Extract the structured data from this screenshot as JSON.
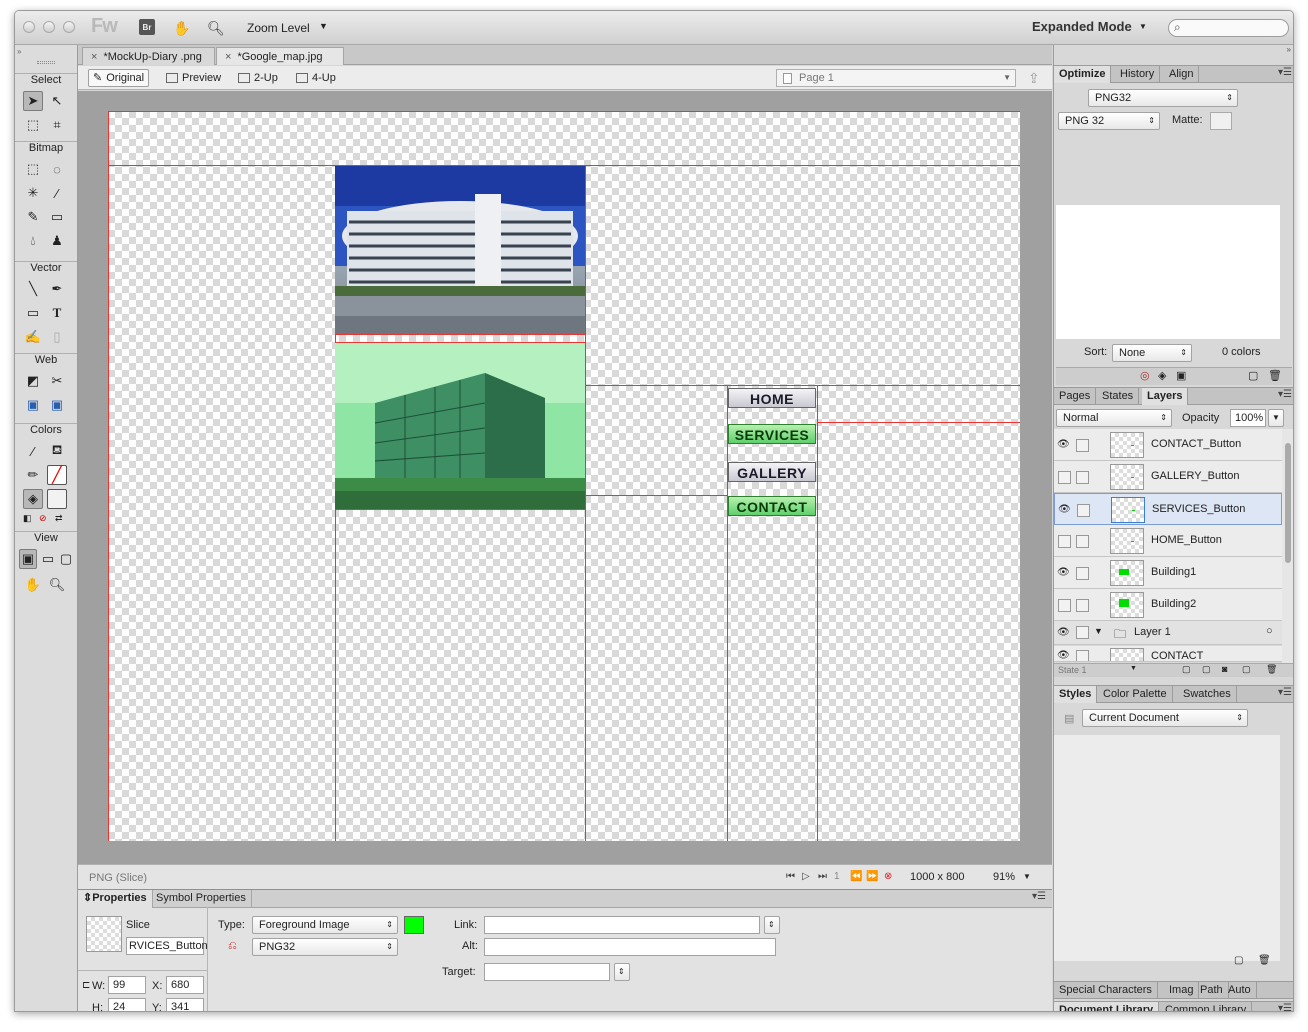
{
  "titlebar": {
    "app_logo": "Fw",
    "bridge_badge": "Br",
    "zoom_level_label": "Zoom Level",
    "workspace_label": "Expanded Mode",
    "search_placeholder": ""
  },
  "tools": {
    "sections": [
      "Select",
      "Bitmap",
      "Vector",
      "Web",
      "Colors",
      "View"
    ]
  },
  "doc_tabs": [
    {
      "label": "*MockUp-Diary .png",
      "close": "×"
    },
    {
      "label": "*Google_map.jpg",
      "close": "×"
    }
  ],
  "view_tabs": {
    "original": "Original",
    "preview": "Preview",
    "two_up": "2-Up",
    "four_up": "4-Up",
    "page_select": "Page 1"
  },
  "canvas": {
    "nav_buttons": [
      {
        "label": "HOME",
        "style": "gray"
      },
      {
        "label": "SERVICES",
        "style": "green"
      },
      {
        "label": "GALLERY",
        "style": "gray"
      },
      {
        "label": "CONTACT",
        "style": "green"
      }
    ]
  },
  "status": {
    "label": "PNG (Slice)",
    "frame_number": "1",
    "doc_size": "1000 x 800",
    "zoom": "91%"
  },
  "properties": {
    "tabs": [
      "Properties",
      "Symbol Properties"
    ],
    "object_kind": "Slice",
    "object_name": "RVICES_Button",
    "type_label": "Type:",
    "type_value": "Foreground Image",
    "format_value": "PNG32",
    "link_label": "Link:",
    "link_value": "",
    "alt_label": "Alt:",
    "alt_value": "",
    "target_label": "Target:",
    "target_value": "",
    "w_label": "W:",
    "w_value": "99",
    "h_label": "H:",
    "h_value": "24",
    "x_label": "X:",
    "x_value": "680",
    "y_label": "Y:",
    "y_value": "341",
    "slice_color": "#00ff00"
  },
  "optimize_panel": {
    "tabs": [
      "Optimize",
      "History",
      "Align"
    ],
    "preset": "PNG32",
    "format": "PNG 32",
    "matte_label": "Matte:",
    "sort_label": "Sort:",
    "sort_value": "None",
    "colors_count": "0 colors"
  },
  "layers_panel": {
    "tabs": [
      "Pages",
      "States",
      "Layers"
    ],
    "blend_mode": "Normal",
    "opacity_label": "Opacity",
    "opacity_value": "100%",
    "layers": [
      {
        "name": "CONTACT_Button",
        "visible": true,
        "selected": false
      },
      {
        "name": "GALLERY_Button",
        "visible": false,
        "selected": false
      },
      {
        "name": "SERVICES_Button",
        "visible": true,
        "selected": true
      },
      {
        "name": "HOME_Button",
        "visible": false,
        "selected": false
      },
      {
        "name": "Building1",
        "visible": true,
        "selected": false
      },
      {
        "name": "Building2",
        "visible": false,
        "selected": false
      }
    ],
    "group_layer": "Layer 1",
    "partial_layer": "CONTACT",
    "state_label": "State 1"
  },
  "styles_panel": {
    "tabs": [
      "Styles",
      "Color Palette",
      "Swatches"
    ],
    "library": "Current Document"
  },
  "bottom_tabs": {
    "row1": [
      "Special Characters",
      "Imag",
      "Path",
      "Auto"
    ],
    "row2": [
      "Document Library",
      "Common Library"
    ]
  }
}
